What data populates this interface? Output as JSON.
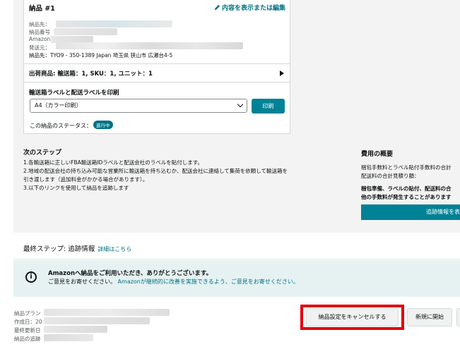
{
  "shipment": {
    "title": "納品 #1",
    "edit_link": "内容を表示または編集",
    "info": {
      "destination": "納品先：",
      "number": "納品番号",
      "amazon": "Amazon",
      "origin": "発送元：",
      "destination_address": "納品先：TYO9 - 350-1389 Japan 埼玉県 狭山市 広瀬台4-5"
    },
    "summary": "出荷商品: 輸送箱：1, SKU：1, ユニット：1",
    "label_section_title": "輸送箱ラベルと配送ラベルを印刷",
    "label_format_value": "A4（カラー印刷）",
    "print_button": "印刷",
    "status_label": "この納品のステータス：",
    "status_badge": "進行中"
  },
  "next_steps": {
    "title": "次のステップ",
    "lines": [
      "1.各輸送箱に正しいFBA輸送箱IDラベルと配送会社のラベルを貼付します。",
      "2.地域の配送会社の持ち込み可能な営業所に輸送箱を持ち込むか、配送会社に連絡して集荷を依頼して輸送箱を",
      "引き渡します（追加料金がかかる場合があります）。",
      "3.以下のリンクを使用して納品を追跡します"
    ]
  },
  "fees": {
    "title": "費用の概要",
    "line1": "梱包手数料とラベル貼付手数料の合計",
    "line2": "配送料の合計見積り額：",
    "warning1": "梱包準備、ラベルの貼付、配送料の合",
    "warning2": "他の手数料が発生することがあります",
    "track_button": "追跡情報を表示"
  },
  "final_step": {
    "label": "最終ステップ: 追跡情報",
    "link": "詳細はこちら"
  },
  "alert": {
    "title": "Amazonへ納品をご利用いただき、ありがとうございます。",
    "text_before": "ご意見をお寄せください。",
    "link": "Amazonが継続的に改善を実施できるよう、ご意見をお寄せください。"
  },
  "meta": {
    "plan": "納品プラン",
    "created": "作成日：20",
    "updated": "最終更新日",
    "tracking": "納品の追跡"
  },
  "buttons": {
    "cancel": "納品設定をキャンセルする",
    "new": "新規に開始"
  },
  "colors": {
    "accent": "#008296",
    "link": "#007185",
    "highlight": "#e3000f"
  }
}
